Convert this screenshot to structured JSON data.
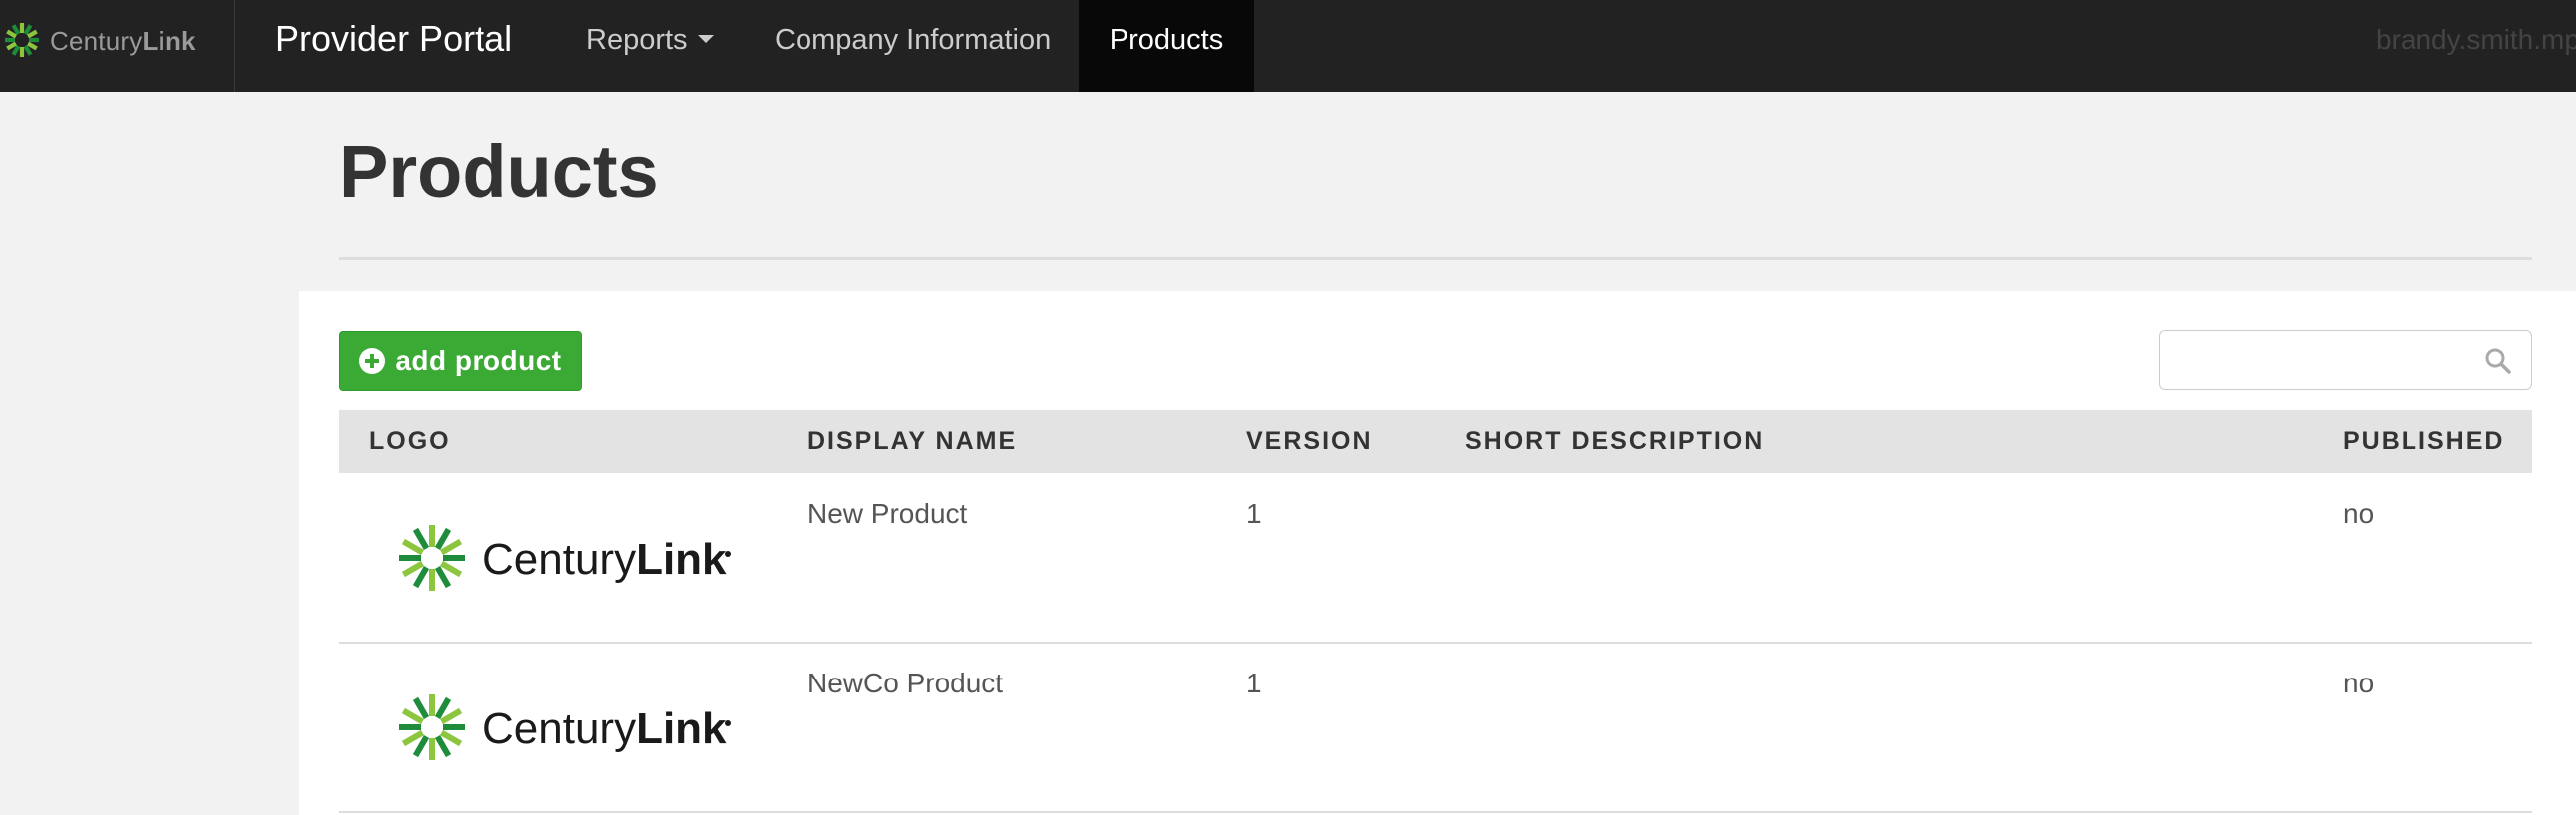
{
  "nav": {
    "brand_text_light": "Century",
    "brand_text_bold": "Link",
    "portal_title": "Provider Portal",
    "items": [
      {
        "label": "Reports"
      },
      {
        "label": "Company Information"
      },
      {
        "label": "Products"
      }
    ],
    "user": "brandy.smith.mp"
  },
  "page": {
    "title": "Products"
  },
  "toolbar": {
    "add_label": "add product",
    "search_placeholder": ""
  },
  "table": {
    "columns": [
      "LOGO",
      "DISPLAY NAME",
      "VERSION",
      "SHORT DESCRIPTION",
      "PUBLISHED"
    ],
    "rows": [
      {
        "logo_text_light": "Century",
        "logo_text_bold": "Link",
        "display_name": "New Product",
        "version": "1",
        "short_description": "",
        "published": "no"
      },
      {
        "logo_text_light": "Century",
        "logo_text_bold": "Link",
        "display_name": "NewCo Product",
        "version": "1",
        "short_description": "",
        "published": "no"
      }
    ]
  },
  "colors": {
    "nav_bg": "#222222",
    "nav_active_bg": "#080808",
    "accent_green": "#3aaa35",
    "logo_dark_green": "#1e8c3a",
    "logo_light_green": "#8cc63f"
  }
}
